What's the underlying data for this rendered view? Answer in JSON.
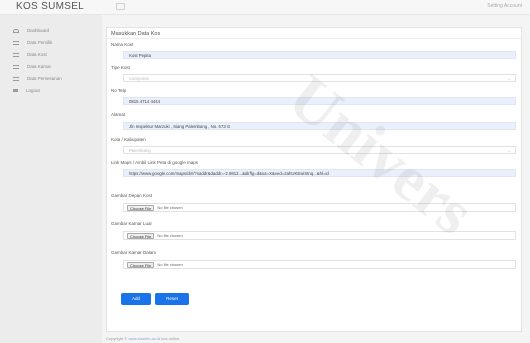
{
  "header": {
    "brand": "KOS SUMSEL",
    "account": "Setting Account"
  },
  "sidebar": {
    "items": [
      {
        "label": "Dashboard",
        "icon": "dashboard-icon"
      },
      {
        "label": "Data Pemilik",
        "icon": "list-icon"
      },
      {
        "label": "Data Kost",
        "icon": "list-icon"
      },
      {
        "label": "Data Kamar",
        "icon": "list-icon"
      },
      {
        "label": "Data Pemesanan",
        "icon": "list-icon"
      },
      {
        "label": "Logout",
        "icon": "logout-icon"
      }
    ]
  },
  "form": {
    "title": "Masukkan Data Kos",
    "nama_label": "Nama Kost",
    "nama_value": "Kost Pepita",
    "tipe_label": "Tipe Kost",
    "tipe_value": "Campuran",
    "telp_label": "No Telp",
    "telp_value": "0815 4714 4444",
    "alamat_label": "Alamat",
    "alamat_value": "Jln Inspektur Marzuki , Siang Palembang , No. 673 G",
    "kota_label": "Kota / Kabupaten",
    "kota_value": "Palembang",
    "maps_label": "Link Maps / Ambil Link Peta di google maps",
    "maps_value": "https://www.google.com/maps/dir//?saddr&daddr=-2.9812...&dirflg=d&sa=X&ved=2ahUKEwiStnq...&hl=id",
    "gambar_depan_label": "Gambar Depan Kost",
    "gambar_luar_label": "Gambar Kamar Luar",
    "gambar_dalam_label": "Gambar Kamar Dalam",
    "file_button": "Choose File",
    "file_text": "No file chosen",
    "add_button": "Add",
    "reset_button": "Reset"
  },
  "footer": {
    "prefix": "Copyright ©",
    "link": "www.kosinfo.ac.id",
    "suffix": "kos online."
  },
  "watermark": "Univers",
  "colors": {
    "primary": "#1a73e8",
    "sidebar_bg": "#ececec",
    "input_bg": "#e9f0fb"
  }
}
